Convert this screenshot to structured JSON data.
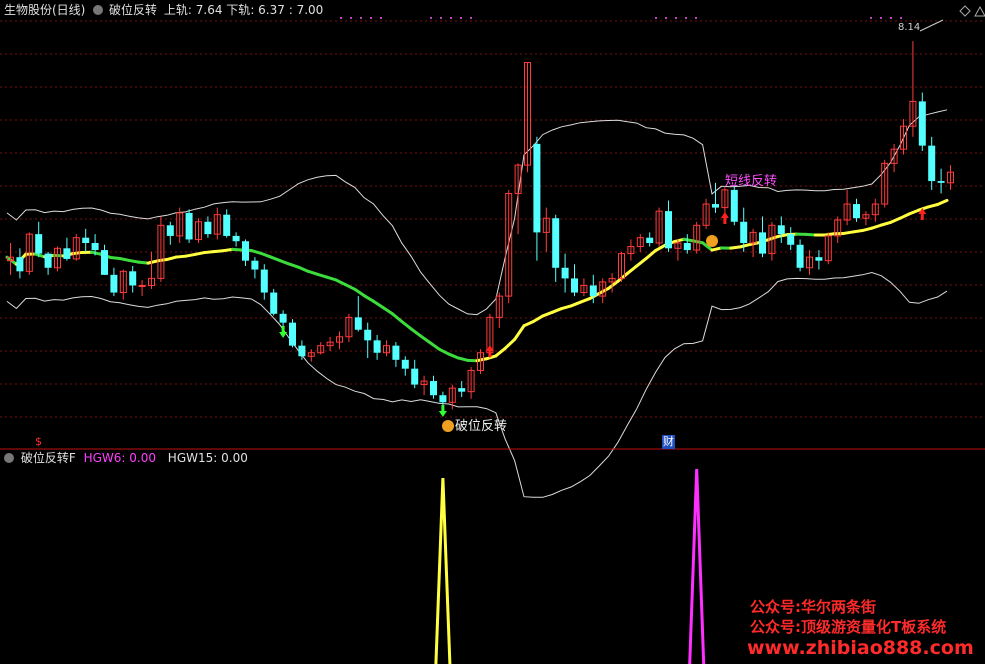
{
  "header": {
    "stock": "生物股份(日线)",
    "indicator": "破位反转",
    "upper_label": "上轨",
    "upper_value": "7.64",
    "lower_label": "下轨",
    "lower_value": "6.37",
    "third_value": "7.00"
  },
  "sub_header": {
    "indicator": "破位反转F",
    "hgw6_label": "HGW6",
    "hgw6_value": "0.00",
    "hgw15_label": "HGW15",
    "hgw15_value": "0.00"
  },
  "annotations": {
    "peak_label": "8.14",
    "break_label": "破位反转",
    "pullback_label": "短线反转",
    "bottom_dollar": "$",
    "bottom_cai": "财"
  },
  "watermark": {
    "line1": "公众号:华尔两条街",
    "line2": "公众号:顶级游资量化T板系统",
    "line3": "www.zhibiao888.com"
  },
  "colors": {
    "background": "#000000",
    "up_candle": "#ff3b3b",
    "down_candle": "#54ffff",
    "mid_green": "#3ddc3d",
    "mid_yellow": "#ffff40",
    "band": "#dcdcdc",
    "hgw6": "#ffff40",
    "hgw15": "#ff30ff",
    "grid": "#7a1010",
    "divider": "#c01010"
  },
  "chart_data": {
    "type": "candlestick",
    "candles": [
      [
        6.9,
        7.0,
        6.82,
        6.92
      ],
      [
        6.92,
        6.97,
        6.8,
        6.84
      ],
      [
        6.84,
        7.06,
        6.82,
        7.05
      ],
      [
        7.05,
        7.12,
        6.92,
        6.94
      ],
      [
        6.94,
        6.95,
        6.82,
        6.86
      ],
      [
        6.86,
        6.98,
        6.84,
        6.97
      ],
      [
        6.97,
        7.03,
        6.9,
        6.91
      ],
      [
        6.91,
        7.05,
        6.9,
        7.03
      ],
      [
        7.03,
        7.08,
        6.95,
        7.0
      ],
      [
        7.0,
        7.05,
        6.93,
        6.96
      ],
      [
        6.96,
        6.99,
        6.82,
        6.82
      ],
      [
        6.82,
        6.86,
        6.7,
        6.72
      ],
      [
        6.72,
        6.85,
        6.68,
        6.84
      ],
      [
        6.84,
        6.87,
        6.72,
        6.76
      ],
      [
        6.76,
        6.79,
        6.7,
        6.76
      ],
      [
        6.76,
        6.95,
        6.74,
        6.8
      ],
      [
        6.8,
        7.15,
        6.78,
        7.1
      ],
      [
        7.1,
        7.12,
        6.99,
        7.04
      ],
      [
        7.04,
        7.2,
        7.0,
        7.17
      ],
      [
        7.17,
        7.19,
        7.0,
        7.02
      ],
      [
        7.02,
        7.14,
        7.0,
        7.12
      ],
      [
        7.12,
        7.15,
        7.03,
        7.05
      ],
      [
        7.05,
        7.2,
        7.02,
        7.16
      ],
      [
        7.16,
        7.19,
        7.03,
        7.04
      ],
      [
        7.04,
        7.06,
        6.98,
        7.01
      ],
      [
        7.01,
        7.02,
        6.87,
        6.9
      ],
      [
        6.9,
        6.92,
        6.8,
        6.85
      ],
      [
        6.85,
        6.88,
        6.68,
        6.72
      ],
      [
        6.72,
        6.74,
        6.59,
        6.6
      ],
      [
        6.6,
        6.62,
        6.52,
        6.55
      ],
      [
        6.55,
        6.57,
        6.41,
        6.42
      ],
      [
        6.42,
        6.45,
        6.34,
        6.36
      ],
      [
        6.36,
        6.4,
        6.33,
        6.38
      ],
      [
        6.38,
        6.44,
        6.37,
        6.42
      ],
      [
        6.42,
        6.47,
        6.39,
        6.44
      ],
      [
        6.44,
        6.5,
        6.4,
        6.47
      ],
      [
        6.47,
        6.6,
        6.44,
        6.58
      ],
      [
        6.58,
        6.7,
        6.5,
        6.51
      ],
      [
        6.51,
        6.55,
        6.35,
        6.45
      ],
      [
        6.45,
        6.48,
        6.34,
        6.38
      ],
      [
        6.38,
        6.45,
        6.36,
        6.42
      ],
      [
        6.42,
        6.44,
        6.3,
        6.34
      ],
      [
        6.34,
        6.36,
        6.25,
        6.29
      ],
      [
        6.29,
        6.34,
        6.18,
        6.2
      ],
      [
        6.2,
        6.25,
        6.14,
        6.22
      ],
      [
        6.22,
        6.25,
        6.12,
        6.14
      ],
      [
        6.14,
        6.16,
        6.08,
        6.1
      ],
      [
        6.1,
        6.2,
        6.06,
        6.18
      ],
      [
        6.18,
        6.22,
        6.13,
        6.16
      ],
      [
        6.16,
        6.3,
        6.12,
        6.28
      ],
      [
        6.28,
        6.4,
        6.26,
        6.38
      ],
      [
        6.38,
        6.6,
        6.35,
        6.58
      ],
      [
        6.58,
        6.72,
        6.52,
        6.7
      ],
      [
        6.7,
        7.3,
        6.66,
        7.28
      ],
      [
        7.28,
        7.45,
        7.05,
        7.44
      ],
      [
        7.44,
        8.02,
        7.4,
        8.02
      ],
      [
        7.56,
        7.6,
        6.9,
        7.06
      ],
      [
        7.06,
        7.2,
        6.95,
        7.14
      ],
      [
        7.14,
        7.16,
        6.78,
        6.86
      ],
      [
        6.86,
        6.94,
        6.72,
        6.8
      ],
      [
        6.8,
        6.88,
        6.7,
        6.72
      ],
      [
        6.72,
        6.8,
        6.7,
        6.76
      ],
      [
        6.76,
        6.82,
        6.66,
        6.7
      ],
      [
        6.7,
        6.8,
        6.66,
        6.78
      ],
      [
        6.78,
        6.83,
        6.72,
        6.8
      ],
      [
        6.8,
        6.95,
        6.78,
        6.94
      ],
      [
        6.94,
        7.02,
        6.9,
        6.98
      ],
      [
        6.98,
        7.05,
        6.95,
        7.03
      ],
      [
        7.03,
        7.06,
        6.98,
        7.0
      ],
      [
        7.0,
        7.2,
        6.98,
        7.18
      ],
      [
        7.18,
        7.24,
        6.95,
        6.97
      ],
      [
        6.97,
        7.02,
        6.9,
        7.0
      ],
      [
        7.0,
        7.05,
        6.94,
        6.96
      ],
      [
        6.96,
        7.12,
        6.94,
        7.1
      ],
      [
        7.1,
        7.25,
        7.08,
        7.22
      ],
      [
        7.22,
        7.34,
        7.17,
        7.2
      ],
      [
        7.2,
        7.32,
        7.12,
        7.3
      ],
      [
        7.3,
        7.32,
        7.1,
        7.12
      ],
      [
        7.12,
        7.2,
        6.95,
        7.0
      ],
      [
        7.0,
        7.08,
        6.92,
        7.06
      ],
      [
        7.06,
        7.15,
        6.92,
        6.94
      ],
      [
        6.94,
        7.12,
        6.9,
        7.1
      ],
      [
        7.1,
        7.15,
        7.0,
        7.05
      ],
      [
        7.05,
        7.09,
        6.96,
        6.99
      ],
      [
        6.99,
        7.02,
        6.84,
        6.86
      ],
      [
        6.86,
        6.96,
        6.82,
        6.92
      ],
      [
        6.92,
        6.96,
        6.85,
        6.9
      ],
      [
        6.9,
        7.06,
        6.88,
        7.04
      ],
      [
        7.04,
        7.15,
        7.0,
        7.13
      ],
      [
        7.13,
        7.3,
        7.1,
        7.22
      ],
      [
        7.22,
        7.25,
        7.12,
        7.14
      ],
      [
        7.14,
        7.18,
        7.1,
        7.16
      ],
      [
        7.16,
        7.25,
        7.12,
        7.22
      ],
      [
        7.22,
        7.47,
        7.2,
        7.45
      ],
      [
        7.45,
        7.56,
        7.4,
        7.53
      ],
      [
        7.53,
        7.7,
        7.5,
        7.66
      ],
      [
        7.66,
        8.14,
        7.6,
        7.8
      ],
      [
        7.8,
        7.85,
        7.52,
        7.55
      ],
      [
        7.55,
        7.6,
        7.3,
        7.35
      ],
      [
        7.35,
        7.42,
        7.28,
        7.34
      ],
      [
        7.34,
        7.44,
        7.3,
        7.4
      ]
    ],
    "upper_band_last": 7.64,
    "lower_band_last": 6.37,
    "mid_last": 7.0,
    "price_high_marked": 8.14,
    "hgw6_spike_index": 46,
    "hgw15_spike_index": 73
  }
}
